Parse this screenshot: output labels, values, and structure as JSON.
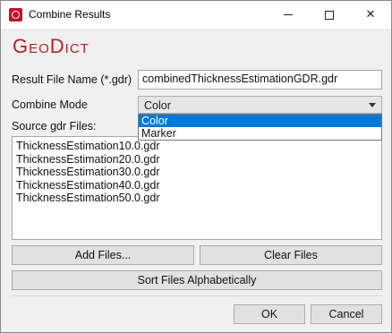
{
  "window": {
    "title": "Combine Results"
  },
  "logo": {
    "text": "GeoDict"
  },
  "result_file": {
    "label": "Result File Name (*.gdr)",
    "value": "combinedThicknessEstimationGDR.gdr"
  },
  "combine_mode": {
    "label": "Combine Mode",
    "selected": "Color",
    "options": [
      "Color",
      "Marker"
    ]
  },
  "source_files": {
    "label": "Source gdr Files:",
    "items": [
      "ThicknessEstimation10.0.gdr",
      "ThicknessEstimation20.0.gdr",
      "ThicknessEstimation30.0.gdr",
      "ThicknessEstimation40.0.gdr",
      "ThicknessEstimation50.0.gdr"
    ]
  },
  "buttons": {
    "add_files": "Add Files...",
    "clear_files": "Clear Files",
    "sort_files": "Sort Files Alphabetically",
    "ok": "OK",
    "cancel": "Cancel"
  },
  "colors": {
    "accent": "#0078d7",
    "logo": "#b81d2e"
  }
}
